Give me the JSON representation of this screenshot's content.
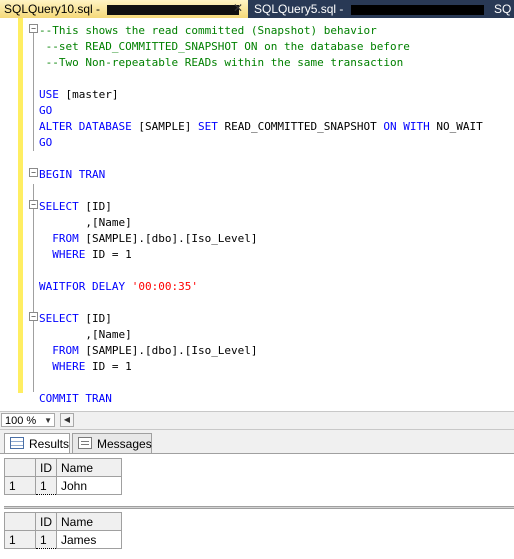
{
  "tabs": [
    {
      "label": "SQLQuery10.sql - ",
      "redacted": true,
      "active": true,
      "close_glyph": "✕"
    },
    {
      "label": "SQLQuery5.sql - ",
      "redacted": true,
      "active": false
    },
    {
      "label": "SQ",
      "active": false
    }
  ],
  "editor": {
    "lines": [
      [
        {
          "t": "cm",
          "v": "--This shows the read committed (Snapshot) behavior"
        }
      ],
      [
        {
          "t": "cm",
          "v": " --set READ_COMMITTED_SNAPSHOT ON on the database before"
        }
      ],
      [
        {
          "t": "cm",
          "v": " --Two Non-repeatable READs within the same transaction"
        }
      ],
      [],
      [
        {
          "t": "kw",
          "v": "USE "
        },
        {
          "t": "pl",
          "v": "[master]"
        }
      ],
      [
        {
          "t": "kw",
          "v": "GO"
        }
      ],
      [
        {
          "t": "kw",
          "v": "ALTER DATABASE "
        },
        {
          "t": "pl",
          "v": "[SAMPLE] "
        },
        {
          "t": "kw",
          "v": "SET "
        },
        {
          "t": "pl",
          "v": "READ_COMMITTED_SNAPSHOT "
        },
        {
          "t": "kw",
          "v": "ON WITH "
        },
        {
          "t": "pl",
          "v": "NO_WAIT"
        }
      ],
      [
        {
          "t": "kw",
          "v": "GO"
        }
      ],
      [],
      [
        {
          "t": "kw",
          "v": "BEGIN TRAN"
        }
      ],
      [],
      [
        {
          "t": "kw",
          "v": "SELECT "
        },
        {
          "t": "pl",
          "v": "[ID]"
        }
      ],
      [
        {
          "t": "pl",
          "v": "       ,[Name]"
        }
      ],
      [
        {
          "t": "kw",
          "v": "  FROM "
        },
        {
          "t": "pl",
          "v": "[SAMPLE].[dbo].[Iso_Level]"
        }
      ],
      [
        {
          "t": "kw",
          "v": "  WHERE "
        },
        {
          "t": "pl",
          "v": "ID = 1"
        }
      ],
      [],
      [
        {
          "t": "kw",
          "v": "WAITFOR DELAY "
        },
        {
          "t": "st",
          "v": "'00:00:35'"
        }
      ],
      [],
      [
        {
          "t": "kw",
          "v": "SELECT "
        },
        {
          "t": "pl",
          "v": "[ID]"
        }
      ],
      [
        {
          "t": "pl",
          "v": "       ,[Name]"
        }
      ],
      [
        {
          "t": "kw",
          "v": "  FROM "
        },
        {
          "t": "pl",
          "v": "[SAMPLE].[dbo].[Iso_Level]"
        }
      ],
      [
        {
          "t": "kw",
          "v": "  WHERE "
        },
        {
          "t": "pl",
          "v": "ID = 1"
        }
      ],
      [],
      [
        {
          "t": "kw",
          "v": "COMMIT TRAN"
        }
      ]
    ],
    "outline_markers": [
      "−",
      "−",
      "−"
    ]
  },
  "status": {
    "zoom": "100 %",
    "zoom_arrow": "▼",
    "scroll_left": "◀"
  },
  "results_tabs": {
    "results_label": "Results",
    "messages_label": "Messages"
  },
  "results": [
    {
      "columns": [
        "ID",
        "Name"
      ],
      "rows": [
        {
          "row_num": "1",
          "id": "1",
          "name": "John"
        }
      ]
    },
    {
      "columns": [
        "ID",
        "Name"
      ],
      "rows": [
        {
          "row_num": "1",
          "id": "1",
          "name": "James"
        }
      ]
    }
  ],
  "colors": {
    "keyword": "#0000ff",
    "comment": "#008000",
    "string": "#ff0000",
    "change_bar": "#ffee62",
    "tabbar_bg": "#293955"
  }
}
